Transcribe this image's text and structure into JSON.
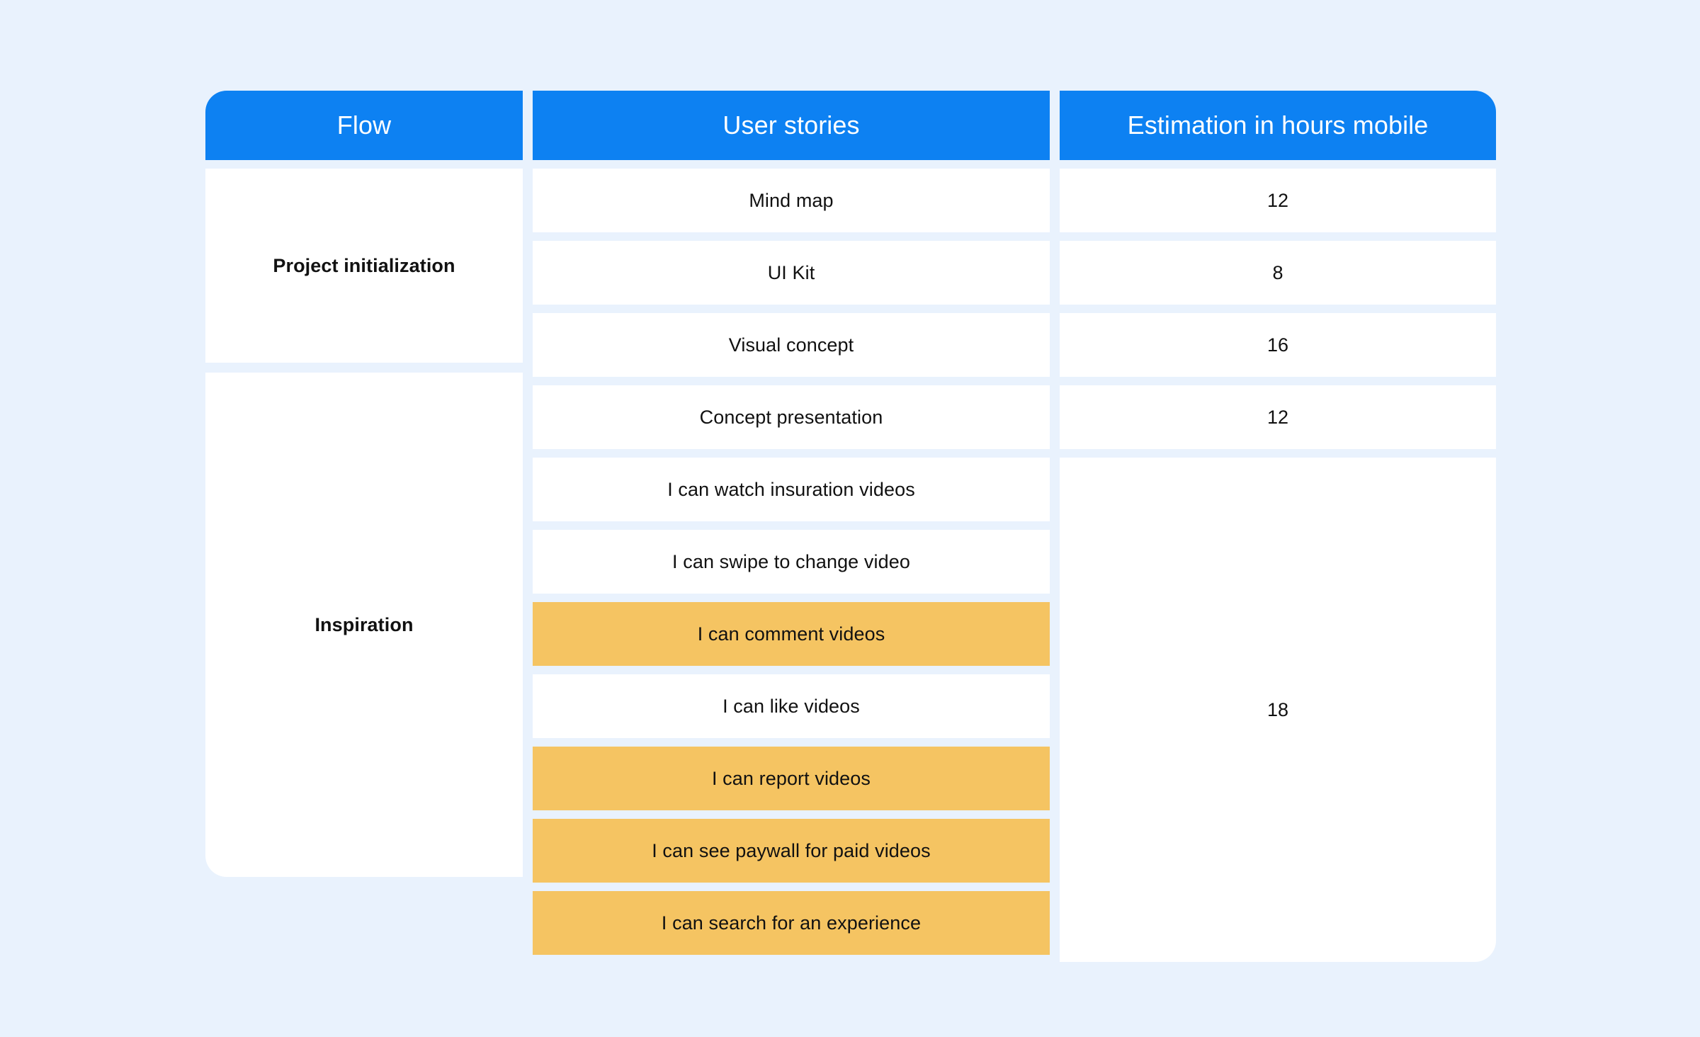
{
  "table": {
    "columns": [
      {
        "key": "flow",
        "label": "Flow"
      },
      {
        "key": "user_stories",
        "label": "User stories"
      },
      {
        "key": "estimation",
        "label": "Estimation in hours mobile"
      }
    ],
    "colors": {
      "page_background": "#e9f2fd",
      "header_background": "#0d81f2",
      "header_text": "#ffffff",
      "cell_background": "#ffffff",
      "highlight_background": "#f5c462",
      "cell_text": "#111111"
    },
    "groups": [
      {
        "flow": "Project initialization",
        "estimation_merged": false,
        "rows": [
          {
            "story": "Mind map",
            "estimation": "12",
            "highlighted": false
          },
          {
            "story": "UI Kit",
            "estimation": "8",
            "highlighted": false
          },
          {
            "story": "Visual concept",
            "estimation": "16",
            "highlighted": false
          },
          {
            "story": "Concept presentation",
            "estimation": "12",
            "highlighted": false
          }
        ]
      },
      {
        "flow": "Inspiration",
        "estimation_merged": true,
        "estimation_value": "18",
        "rows": [
          {
            "story": "I can watch insuration videos",
            "highlighted": false
          },
          {
            "story": "I can swipe to change video",
            "highlighted": false
          },
          {
            "story": "I can comment videos",
            "highlighted": true
          },
          {
            "story": "I can like videos",
            "highlighted": false
          },
          {
            "story": "I can report videos",
            "highlighted": true
          },
          {
            "story": "I can see paywall for paid videos",
            "highlighted": true
          },
          {
            "story": "I can search for an experience",
            "highlighted": true
          }
        ]
      }
    ]
  }
}
